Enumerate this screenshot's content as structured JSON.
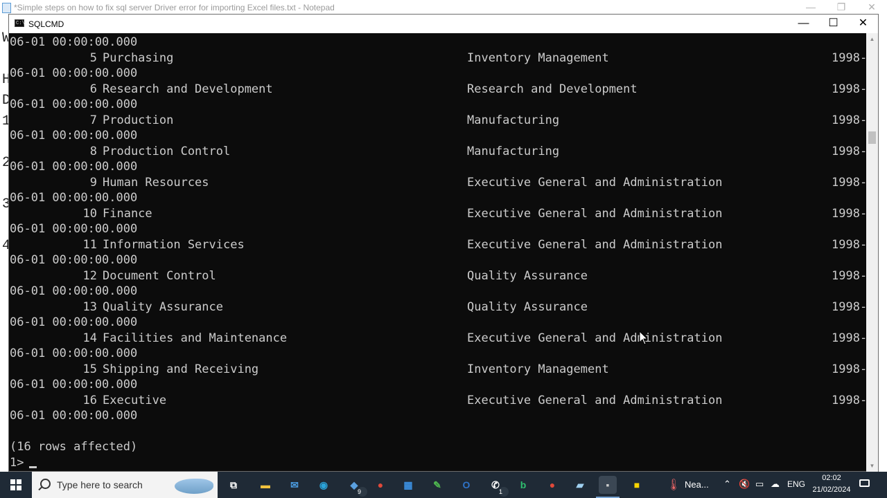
{
  "background_window": {
    "title": "*Simple steps on how to fix sql server Driver error for importing Excel files.txt - Notepad",
    "left_fragments": [
      "W",
      "H",
      "D",
      "1",
      "2",
      "3",
      "4"
    ]
  },
  "console_window": {
    "title": "SQLCMD",
    "icon_text": "C:\\",
    "controls": {
      "minimize": "—",
      "maximize": "☐",
      "close": "✕"
    }
  },
  "console": {
    "top_line": "06-01 00:00:00.000",
    "rows": [
      {
        "id": "5",
        "name": "Purchasing",
        "group": "Inventory Management",
        "year": "1998-",
        "date_cont": "06-01 00:00:00.000"
      },
      {
        "id": "6",
        "name": "Research and Development",
        "group": "Research and Development",
        "year": "1998-",
        "date_cont": "06-01 00:00:00.000"
      },
      {
        "id": "7",
        "name": "Production",
        "group": "Manufacturing",
        "year": "1998-",
        "date_cont": "06-01 00:00:00.000"
      },
      {
        "id": "8",
        "name": "Production Control",
        "group": "Manufacturing",
        "year": "1998-",
        "date_cont": "06-01 00:00:00.000"
      },
      {
        "id": "9",
        "name": "Human Resources",
        "group": "Executive General and Administration",
        "year": "1998-",
        "date_cont": "06-01 00:00:00.000"
      },
      {
        "id": "10",
        "name": "Finance",
        "group": "Executive General and Administration",
        "year": "1998-",
        "date_cont": "06-01 00:00:00.000"
      },
      {
        "id": "11",
        "name": "Information Services",
        "group": "Executive General and Administration",
        "year": "1998-",
        "date_cont": "06-01 00:00:00.000"
      },
      {
        "id": "12",
        "name": "Document Control",
        "group": "Quality Assurance",
        "year": "1998-",
        "date_cont": "06-01 00:00:00.000"
      },
      {
        "id": "13",
        "name": "Quality Assurance",
        "group": "Quality Assurance",
        "year": "1998-",
        "date_cont": "06-01 00:00:00.000"
      },
      {
        "id": "14",
        "name": "Facilities and Maintenance",
        "group": "Executive General and Administration",
        "year": "1998-",
        "date_cont": "06-01 00:00:00.000"
      },
      {
        "id": "15",
        "name": "Shipping and Receiving",
        "group": "Inventory Management",
        "year": "1998-",
        "date_cont": "06-01 00:00:00.000"
      },
      {
        "id": "16",
        "name": "Executive",
        "group": "Executive General and Administration",
        "year": "1998-",
        "date_cont": "06-01 00:00:00.000"
      }
    ],
    "rows_affected": "(16 rows affected)",
    "prompt": "1>"
  },
  "taskbar": {
    "search_placeholder": "Type here to search",
    "apps": [
      {
        "name": "task-view-icon",
        "glyph": "⧉",
        "color": "#ffffff"
      },
      {
        "name": "file-explorer-icon",
        "glyph": "▬",
        "color": "#f2c23e"
      },
      {
        "name": "mail-icon",
        "glyph": "✉",
        "color": "#4a9be0"
      },
      {
        "name": "edge-icon",
        "glyph": "◉",
        "color": "#2ba3d9"
      },
      {
        "name": "teams-icon",
        "glyph": "◆",
        "color": "#5aa0e0",
        "badge": "9"
      },
      {
        "name": "chrome-icon",
        "glyph": "●",
        "color": "#e0493a"
      },
      {
        "name": "store-icon",
        "glyph": "▦",
        "color": "#3b8fe0"
      },
      {
        "name": "excel-icon",
        "glyph": "✎",
        "color": "#4fb84f"
      },
      {
        "name": "outlook-icon",
        "glyph": "O",
        "color": "#2f73c8"
      },
      {
        "name": "whatsapp-icon",
        "glyph": "✆",
        "color": "#ffffff",
        "badge": "1"
      },
      {
        "name": "bing-icon",
        "glyph": "b",
        "color": "#2fbf6f"
      },
      {
        "name": "chrome-profile-icon",
        "glyph": "●",
        "color": "#e0493a"
      },
      {
        "name": "notepad-icon",
        "glyph": "▰",
        "color": "#9fd0f0"
      },
      {
        "name": "cmd-icon",
        "glyph": "▪",
        "color": "#cccccc",
        "active": true
      },
      {
        "name": "sticky-notes-icon",
        "glyph": "■",
        "color": "#f8d400"
      }
    ],
    "weather_text": "Nea...",
    "language": "ENG",
    "time": "02:02",
    "date": "21/02/2024"
  }
}
